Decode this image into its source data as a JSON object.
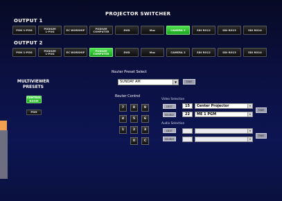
{
  "app": {
    "title": "PROJECTOR SWITCHER"
  },
  "output1": {
    "label": "OUTPUT 1",
    "buttons": [
      {
        "label": "POH 1-POG",
        "active": false
      },
      {
        "label": "PODIUM\n1-POG",
        "active": false
      },
      {
        "label": "EC WORSHIP",
        "active": false
      },
      {
        "label": "PODIUM\nCOMPUTER",
        "active": false
      },
      {
        "label": "DVD",
        "active": false
      },
      {
        "label": "Mac",
        "active": false
      },
      {
        "label": "CAMERA 2",
        "active": true
      },
      {
        "label": "SDI RO12",
        "active": false
      },
      {
        "label": "SDI RO13",
        "active": false
      },
      {
        "label": "SDI RO14",
        "active": false
      }
    ]
  },
  "output2": {
    "label": "OUTPUT 2",
    "buttons": [
      {
        "label": "POH 1-POG",
        "active": false
      },
      {
        "label": "PODIUM\n1-POG",
        "active": false
      },
      {
        "label": "EC WORSHIP",
        "active": false
      },
      {
        "label": "PODIUM\nCOMPUTER",
        "active": true
      },
      {
        "label": "DVD",
        "active": false
      },
      {
        "label": "Mac",
        "active": false
      },
      {
        "label": "CAMERA 2",
        "active": false
      },
      {
        "label": "SDI RO12",
        "active": false
      },
      {
        "label": "SDI RO13",
        "active": false
      },
      {
        "label": "SDI RO14",
        "active": false
      }
    ]
  },
  "multiviewer": {
    "title": "MULTIVIEWER\nPRESETS",
    "control_room_label": "CONTROL\nROOM",
    "poh_label": "POH"
  },
  "router_preset": {
    "label": "Router Preset Select",
    "selected": "SUNDAY AM",
    "take_label": "TAKE"
  },
  "router_control": {
    "label": "Router Control",
    "keys": [
      "7",
      "8",
      "9",
      "4",
      "5",
      "6",
      "1",
      "2",
      "3",
      "0",
      "C"
    ]
  },
  "video_selection": {
    "label": "Video Selection",
    "dest_label": "DEST",
    "source_label": "SOURCE",
    "dest_number": "15",
    "dest_name": "Center Projector",
    "source_number": "22",
    "source_name": "ME 1 PGM",
    "take_label": "TAKE"
  },
  "audio_selection": {
    "label": "Audio Selection",
    "dest_label": "DEST",
    "source_label": "SOURCE",
    "take_label": "TAKE"
  },
  "colors": {
    "active_green": "#2cc52c",
    "button_dark": "#1a1a1a",
    "background": "#0b1040"
  }
}
